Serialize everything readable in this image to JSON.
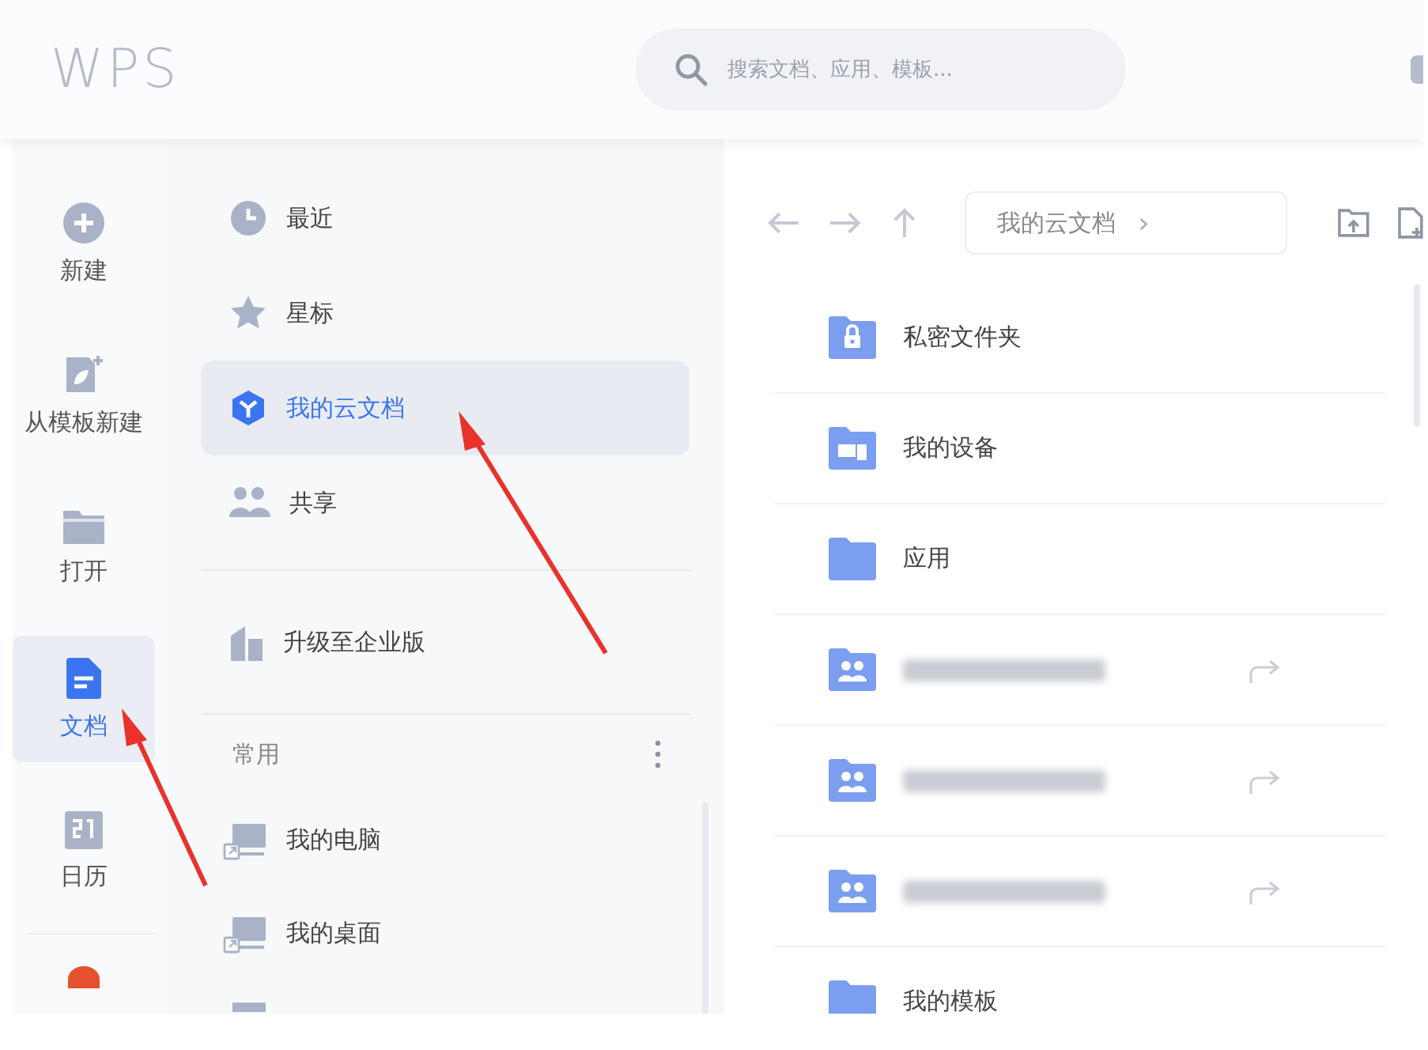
{
  "header": {
    "logo": "WPS",
    "search": {
      "placeholder": "搜索文档、应用、模板..."
    }
  },
  "rail": [
    {
      "label": "新建",
      "kind": "new",
      "selected": false
    },
    {
      "label": "从模板新建",
      "kind": "template",
      "selected": false
    },
    {
      "label": "打开",
      "kind": "open",
      "selected": false
    },
    {
      "label": "文档",
      "kind": "docs",
      "selected": true
    },
    {
      "label": "日历",
      "kind": "calendar",
      "selected": false
    }
  ],
  "nav": {
    "items": [
      {
        "label": "最近",
        "kind": "clock",
        "selected": false
      },
      {
        "label": "星标",
        "kind": "star",
        "selected": false
      },
      {
        "label": "我的云文档",
        "kind": "cloud",
        "selected": true
      },
      {
        "label": "共享",
        "kind": "people",
        "selected": false
      }
    ],
    "upgrade": "升级至企业版",
    "section": "常用",
    "common": [
      {
        "label": "我的电脑",
        "kind": "computer"
      },
      {
        "label": "我的桌面",
        "kind": "computer"
      }
    ]
  },
  "toolbar": {
    "breadcrumb": "我的云文档",
    "separator": "›"
  },
  "files": [
    {
      "name": "私密文件夹",
      "kind": "lock"
    },
    {
      "name": "我的设备",
      "kind": "device"
    },
    {
      "name": "应用",
      "kind": "plain"
    },
    {
      "kind": "shared"
    },
    {
      "kind": "shared"
    },
    {
      "kind": "shared"
    },
    {
      "name": "我的模板",
      "kind": "plain"
    }
  ]
}
